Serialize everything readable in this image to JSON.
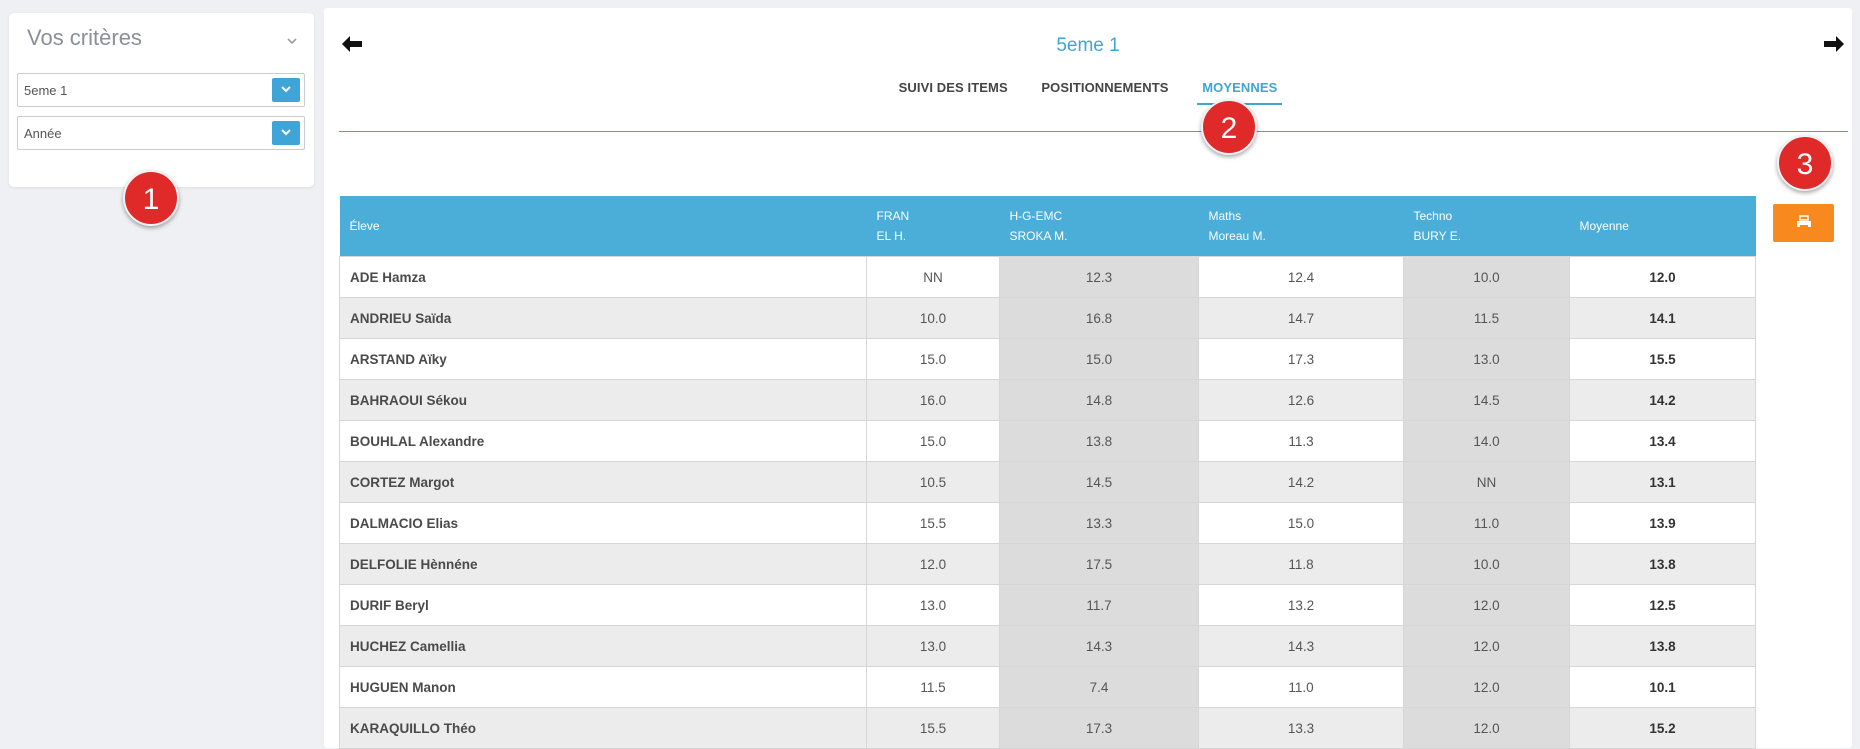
{
  "criteria": {
    "title": "Vos critères",
    "class_select": {
      "value": "5eme 1"
    },
    "year_select": {
      "value": "Année"
    }
  },
  "header": {
    "class_title": "5eme 1",
    "tabs": [
      {
        "label": "SUIVI DES ITEMS",
        "active": false
      },
      {
        "label": "POSITIONNEMENTS",
        "active": false
      },
      {
        "label": "MOYENNES",
        "active": true
      }
    ]
  },
  "table": {
    "columns": [
      {
        "line1": "Éleve",
        "line2": ""
      },
      {
        "line1": "FRAN",
        "line2": "EL H."
      },
      {
        "line1": "H-G-EMC",
        "line2": "SROKA M."
      },
      {
        "line1": "Maths",
        "line2": "Moreau M."
      },
      {
        "line1": "Techno",
        "line2": "BURY E."
      },
      {
        "line1": "Moyenne",
        "line2": ""
      }
    ],
    "rows": [
      [
        "ADE Hamza",
        "NN",
        "12.3",
        "12.4",
        "10.0",
        "12.0"
      ],
      [
        "ANDRIEU Saïda",
        "10.0",
        "16.8",
        "14.7",
        "11.5",
        "14.1"
      ],
      [
        "ARSTAND Aïky",
        "15.0",
        "15.0",
        "17.3",
        "13.0",
        "15.5"
      ],
      [
        "BAHRAOUI Sékou",
        "16.0",
        "14.8",
        "12.6",
        "14.5",
        "14.2"
      ],
      [
        "BOUHLAL Alexandre",
        "15.0",
        "13.8",
        "11.3",
        "14.0",
        "13.4"
      ],
      [
        "CORTEZ Margot",
        "10.5",
        "14.5",
        "14.2",
        "NN",
        "13.1"
      ],
      [
        "DALMACIO Elias",
        "15.5",
        "13.3",
        "15.0",
        "11.0",
        "13.9"
      ],
      [
        "DELFOLIE Hènnéne",
        "12.0",
        "17.5",
        "11.8",
        "10.0",
        "13.8"
      ],
      [
        "DURIF Beryl",
        "13.0",
        "11.7",
        "13.2",
        "12.0",
        "12.5"
      ],
      [
        "HUCHEZ Camellia",
        "13.0",
        "14.3",
        "14.3",
        "12.0",
        "13.8"
      ],
      [
        "HUGUEN Manon",
        "11.5",
        "7.4",
        "11.0",
        "12.0",
        "10.1"
      ],
      [
        "KARAQUILLO Théo",
        "15.5",
        "17.3",
        "13.3",
        "12.0",
        "15.2"
      ]
    ]
  },
  "markers": [
    "1",
    "2",
    "3"
  ],
  "colors": {
    "accent": "#3ea5d6",
    "header_bg": "#4aaed8",
    "print_button": "#f7891f",
    "marker": "#e02a2a"
  },
  "icons": {
    "prev": "arrow-left-icon",
    "next": "arrow-right-icon",
    "print": "print-icon",
    "collapse": "chevron-down-icon"
  }
}
